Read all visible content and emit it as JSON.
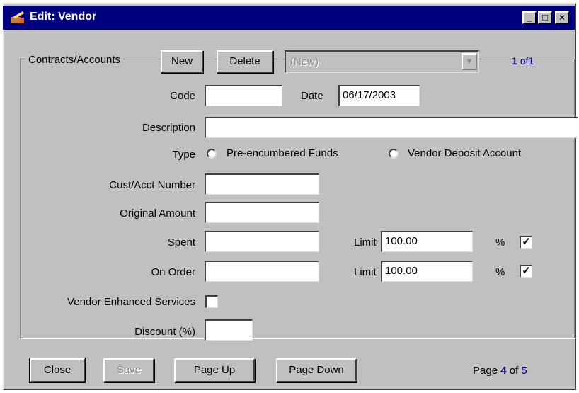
{
  "window": {
    "title": "Edit: Vendor"
  },
  "titlebar_buttons": {
    "minimize": "_",
    "maximize": "□",
    "close": "×"
  },
  "group": {
    "legend": "Contracts/Accounts",
    "new_label": "New",
    "delete_label": "Delete",
    "selector_value": "(New)",
    "record_current": "1",
    "record_of": "of",
    "record_total": "1"
  },
  "form": {
    "code_label": "Code",
    "code_value": "",
    "date_label": "Date",
    "date_value": "06/17/2003",
    "description_label": "Description",
    "description_value": "",
    "type_label": "Type",
    "type_option_1": "Pre-encumbered Funds",
    "type_option_2": "Vendor Deposit Account",
    "cust_acct_label": "Cust/Acct Number",
    "cust_acct_value": "",
    "original_amount_label": "Original Amount",
    "original_amount_value": "",
    "spent_label": "Spent",
    "spent_value": "",
    "spent_limit_label": "Limit",
    "spent_limit_value": "100.00",
    "spent_pct_label": "%",
    "spent_pct_checked": true,
    "on_order_label": "On Order",
    "on_order_value": "",
    "on_order_limit_label": "Limit",
    "on_order_limit_value": "100.00",
    "on_order_pct_label": "%",
    "on_order_pct_checked": true,
    "vendor_enhanced_label": "Vendor Enhanced Services",
    "vendor_enhanced_checked": false,
    "discount_label": "Discount (%)",
    "discount_value": ""
  },
  "footer": {
    "close_label": "Close",
    "save_label": "Save",
    "page_up_label": "Page Up",
    "page_down_label": "Page Down",
    "page_label": "Page",
    "page_current": "4",
    "page_of": "of",
    "page_total": "5"
  },
  "check_mark": "✓"
}
